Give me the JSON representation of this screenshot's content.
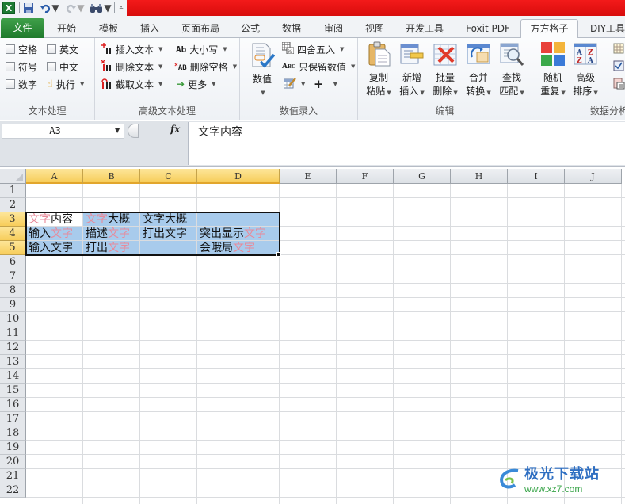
{
  "qat": {
    "app_icon": "excel-icon",
    "icons": [
      "save-icon",
      "undo-icon",
      "redo-icon",
      "find-icon",
      "customize-qat-icon"
    ]
  },
  "tabs": [
    {
      "label": "文件",
      "active": false,
      "file": true
    },
    {
      "label": "开始",
      "active": false
    },
    {
      "label": "模板",
      "active": false
    },
    {
      "label": "插入",
      "active": false
    },
    {
      "label": "页面布局",
      "active": false
    },
    {
      "label": "公式",
      "active": false
    },
    {
      "label": "数据",
      "active": false
    },
    {
      "label": "审阅",
      "active": false
    },
    {
      "label": "视图",
      "active": false
    },
    {
      "label": "开发工具",
      "active": false
    },
    {
      "label": "Foxit PDF",
      "active": false
    },
    {
      "label": "方方格子",
      "active": true
    },
    {
      "label": "DIY工具",
      "active": false
    }
  ],
  "ribbon": {
    "text_processing": {
      "label": "文本处理",
      "checkboxes": [
        {
          "label": "空格",
          "checked": false
        },
        {
          "label": "英文",
          "checked": false
        },
        {
          "label": "符号",
          "checked": false
        },
        {
          "label": "中文",
          "checked": false
        },
        {
          "label": "数字",
          "checked": false
        }
      ],
      "execute": "执行"
    },
    "advanced_text": {
      "label": "高级文本处理",
      "items": [
        {
          "label": "插入文本",
          "icon": "insert-text-icon"
        },
        {
          "label": "删除文本",
          "icon": "delete-text-icon"
        },
        {
          "label": "截取文本",
          "icon": "extract-text-icon"
        },
        {
          "label": "大小写",
          "icon": "case-icon",
          "glyph": "Ab"
        },
        {
          "label": "删除空格",
          "icon": "delete-space-icon",
          "glyph": "AB"
        },
        {
          "label": "更多",
          "icon": "more-arrow-icon"
        }
      ]
    },
    "value_entry": {
      "label": "数值录入",
      "big_button": "数值",
      "items": [
        {
          "label": "四舍五入",
          "icon": "round-icon"
        },
        {
          "label": "只保留数值",
          "icon": "keep-values-icon",
          "glyph": "Abc"
        },
        {
          "label": "",
          "icon": "edit-table-icon"
        },
        {
          "label": "+",
          "icon": "plus-icon"
        }
      ]
    },
    "edit": {
      "label": "编辑",
      "buttons": [
        {
          "line1": "复制",
          "line2": "粘贴",
          "icon": "copy-paste-icon"
        },
        {
          "line1": "新增",
          "line2": "插入",
          "icon": "new-insert-icon"
        },
        {
          "line1": "批量",
          "line2": "删除",
          "icon": "batch-delete-icon"
        },
        {
          "line1": "合并",
          "line2": "转换",
          "icon": "merge-convert-icon"
        },
        {
          "line1": "查找",
          "line2": "匹配",
          "icon": "find-match-icon"
        }
      ]
    },
    "data_analysis": {
      "label": "数据分析",
      "buttons": [
        {
          "line1": "随机",
          "line2": "重复",
          "icon": "random-repeat-icon"
        },
        {
          "line1": "高级",
          "line2": "排序",
          "icon": "advanced-sort-icon"
        }
      ]
    }
  },
  "formula_bar": {
    "name_box": "A3",
    "fx": "fx",
    "content": "文字内容"
  },
  "sheet": {
    "columns": [
      "A",
      "B",
      "C",
      "D",
      "E",
      "F",
      "G",
      "H",
      "I",
      "J"
    ],
    "selected_columns": [
      "A",
      "B",
      "C",
      "D"
    ],
    "rows": [
      "1",
      "2",
      "3",
      "4",
      "5",
      "6",
      "7",
      "8",
      "9",
      "10",
      "11",
      "12",
      "13",
      "14",
      "15",
      "16",
      "17",
      "18",
      "19",
      "20",
      "21",
      "22"
    ],
    "selected_rows": [
      "3",
      "4",
      "5"
    ],
    "active_cell": "A3",
    "selection": "A3:D5",
    "cells": {
      "A3": [
        {
          "t": "文字",
          "hl": true
        },
        {
          "t": "内容",
          "hl": false
        }
      ],
      "B3": [
        {
          "t": "文字",
          "hl": true
        },
        {
          "t": "大概",
          "hl": false
        }
      ],
      "C3": [
        {
          "t": "文字大概",
          "hl": false
        }
      ],
      "A4": [
        {
          "t": "输入",
          "hl": false
        },
        {
          "t": "文字",
          "hl": true
        }
      ],
      "B4": [
        {
          "t": "描述",
          "hl": false
        },
        {
          "t": "文字",
          "hl": true
        }
      ],
      "C4": [
        {
          "t": "打出文字",
          "hl": false
        }
      ],
      "D4": [
        {
          "t": "突出显示",
          "hl": false
        },
        {
          "t": "文字",
          "hl": true
        }
      ],
      "A5": [
        {
          "t": "输入文字",
          "hl": false
        }
      ],
      "B5": [
        {
          "t": "打出",
          "hl": false
        },
        {
          "t": "文字",
          "hl": true
        }
      ],
      "D5": [
        {
          "t": "会哦局",
          "hl": false
        },
        {
          "t": "文字",
          "hl": true
        }
      ]
    },
    "highlight_color": "#e88a9a",
    "selection_color": "#a8cbec"
  },
  "watermark": {
    "title": "极光下载站",
    "url": "www.xz7.com"
  }
}
